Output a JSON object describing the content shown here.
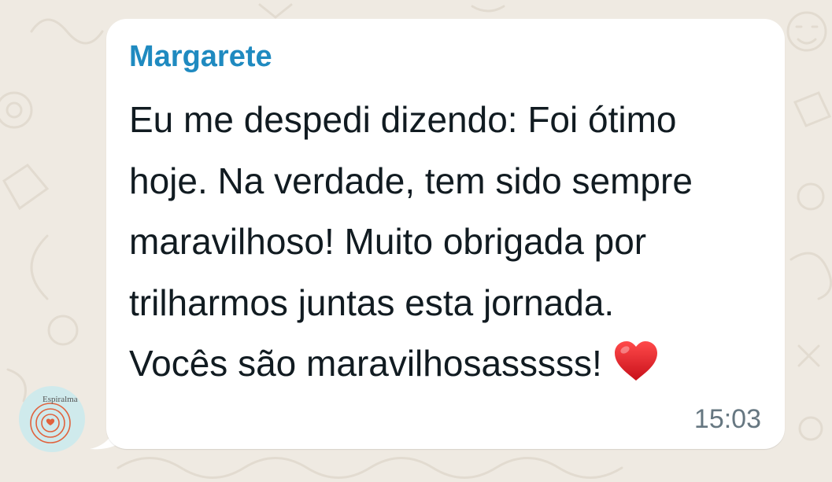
{
  "chat": {
    "background_color": "#efeae2",
    "avatar": {
      "icon": "spiral-logo-icon",
      "logo_text": "Espiralma"
    },
    "message": {
      "sender": "Margarete",
      "sender_color": "#1f8ac0",
      "lines": [
        "Eu me despedi dizendo: Foi ótimo",
        "hoje. Na verdade, tem sido sempre",
        "maravilhoso! Muito obrigada por",
        "trilharmos juntas esta jornada.",
        "Vocês são maravilhosasssss!"
      ],
      "emoji": "red-heart-icon",
      "time": "15:03"
    }
  }
}
